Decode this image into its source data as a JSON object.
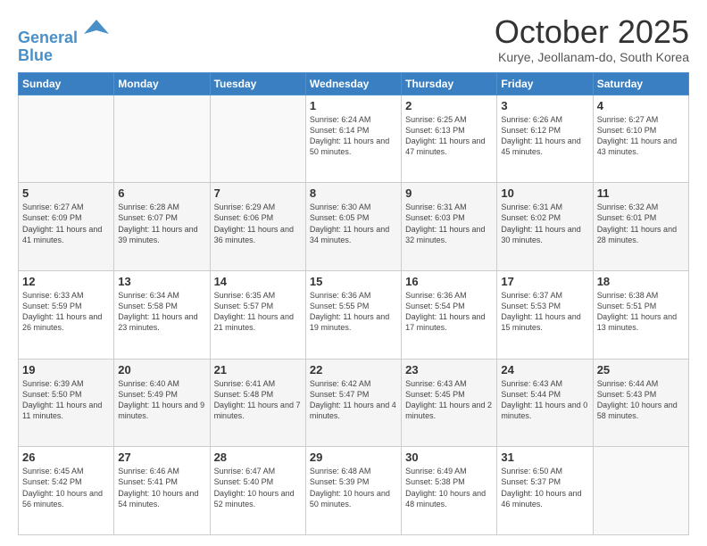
{
  "logo": {
    "line1": "General",
    "line2": "Blue"
  },
  "title": "October 2025",
  "subtitle": "Kurye, Jeollanam-do, South Korea",
  "days_of_week": [
    "Sunday",
    "Monday",
    "Tuesday",
    "Wednesday",
    "Thursday",
    "Friday",
    "Saturday"
  ],
  "weeks": [
    [
      {
        "day": "",
        "info": ""
      },
      {
        "day": "",
        "info": ""
      },
      {
        "day": "",
        "info": ""
      },
      {
        "day": "1",
        "info": "Sunrise: 6:24 AM\nSunset: 6:14 PM\nDaylight: 11 hours\nand 50 minutes."
      },
      {
        "day": "2",
        "info": "Sunrise: 6:25 AM\nSunset: 6:13 PM\nDaylight: 11 hours\nand 47 minutes."
      },
      {
        "day": "3",
        "info": "Sunrise: 6:26 AM\nSunset: 6:12 PM\nDaylight: 11 hours\nand 45 minutes."
      },
      {
        "day": "4",
        "info": "Sunrise: 6:27 AM\nSunset: 6:10 PM\nDaylight: 11 hours\nand 43 minutes."
      }
    ],
    [
      {
        "day": "5",
        "info": "Sunrise: 6:27 AM\nSunset: 6:09 PM\nDaylight: 11 hours\nand 41 minutes."
      },
      {
        "day": "6",
        "info": "Sunrise: 6:28 AM\nSunset: 6:07 PM\nDaylight: 11 hours\nand 39 minutes."
      },
      {
        "day": "7",
        "info": "Sunrise: 6:29 AM\nSunset: 6:06 PM\nDaylight: 11 hours\nand 36 minutes."
      },
      {
        "day": "8",
        "info": "Sunrise: 6:30 AM\nSunset: 6:05 PM\nDaylight: 11 hours\nand 34 minutes."
      },
      {
        "day": "9",
        "info": "Sunrise: 6:31 AM\nSunset: 6:03 PM\nDaylight: 11 hours\nand 32 minutes."
      },
      {
        "day": "10",
        "info": "Sunrise: 6:31 AM\nSunset: 6:02 PM\nDaylight: 11 hours\nand 30 minutes."
      },
      {
        "day": "11",
        "info": "Sunrise: 6:32 AM\nSunset: 6:01 PM\nDaylight: 11 hours\nand 28 minutes."
      }
    ],
    [
      {
        "day": "12",
        "info": "Sunrise: 6:33 AM\nSunset: 5:59 PM\nDaylight: 11 hours\nand 26 minutes."
      },
      {
        "day": "13",
        "info": "Sunrise: 6:34 AM\nSunset: 5:58 PM\nDaylight: 11 hours\nand 23 minutes."
      },
      {
        "day": "14",
        "info": "Sunrise: 6:35 AM\nSunset: 5:57 PM\nDaylight: 11 hours\nand 21 minutes."
      },
      {
        "day": "15",
        "info": "Sunrise: 6:36 AM\nSunset: 5:55 PM\nDaylight: 11 hours\nand 19 minutes."
      },
      {
        "day": "16",
        "info": "Sunrise: 6:36 AM\nSunset: 5:54 PM\nDaylight: 11 hours\nand 17 minutes."
      },
      {
        "day": "17",
        "info": "Sunrise: 6:37 AM\nSunset: 5:53 PM\nDaylight: 11 hours\nand 15 minutes."
      },
      {
        "day": "18",
        "info": "Sunrise: 6:38 AM\nSunset: 5:51 PM\nDaylight: 11 hours\nand 13 minutes."
      }
    ],
    [
      {
        "day": "19",
        "info": "Sunrise: 6:39 AM\nSunset: 5:50 PM\nDaylight: 11 hours\nand 11 minutes."
      },
      {
        "day": "20",
        "info": "Sunrise: 6:40 AM\nSunset: 5:49 PM\nDaylight: 11 hours\nand 9 minutes."
      },
      {
        "day": "21",
        "info": "Sunrise: 6:41 AM\nSunset: 5:48 PM\nDaylight: 11 hours\nand 7 minutes."
      },
      {
        "day": "22",
        "info": "Sunrise: 6:42 AM\nSunset: 5:47 PM\nDaylight: 11 hours\nand 4 minutes."
      },
      {
        "day": "23",
        "info": "Sunrise: 6:43 AM\nSunset: 5:45 PM\nDaylight: 11 hours\nand 2 minutes."
      },
      {
        "day": "24",
        "info": "Sunrise: 6:43 AM\nSunset: 5:44 PM\nDaylight: 11 hours\nand 0 minutes."
      },
      {
        "day": "25",
        "info": "Sunrise: 6:44 AM\nSunset: 5:43 PM\nDaylight: 10 hours\nand 58 minutes."
      }
    ],
    [
      {
        "day": "26",
        "info": "Sunrise: 6:45 AM\nSunset: 5:42 PM\nDaylight: 10 hours\nand 56 minutes."
      },
      {
        "day": "27",
        "info": "Sunrise: 6:46 AM\nSunset: 5:41 PM\nDaylight: 10 hours\nand 54 minutes."
      },
      {
        "day": "28",
        "info": "Sunrise: 6:47 AM\nSunset: 5:40 PM\nDaylight: 10 hours\nand 52 minutes."
      },
      {
        "day": "29",
        "info": "Sunrise: 6:48 AM\nSunset: 5:39 PM\nDaylight: 10 hours\nand 50 minutes."
      },
      {
        "day": "30",
        "info": "Sunrise: 6:49 AM\nSunset: 5:38 PM\nDaylight: 10 hours\nand 48 minutes."
      },
      {
        "day": "31",
        "info": "Sunrise: 6:50 AM\nSunset: 5:37 PM\nDaylight: 10 hours\nand 46 minutes."
      },
      {
        "day": "",
        "info": ""
      }
    ]
  ],
  "colors": {
    "header_bg": "#3a7fc1",
    "accent": "#4a90c8"
  }
}
